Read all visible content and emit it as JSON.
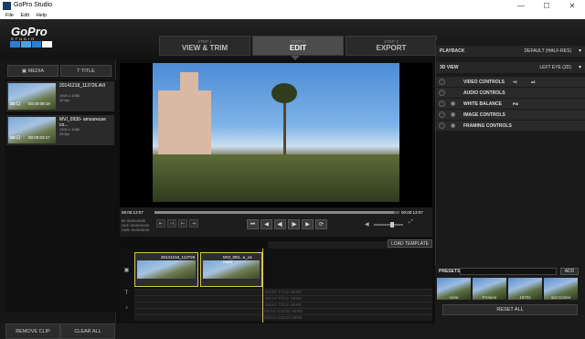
{
  "window": {
    "title": "GoPro Studio",
    "min": "—",
    "max": "☐",
    "close": "✕"
  },
  "menu": [
    "File",
    "Edit",
    "Help"
  ],
  "logo": {
    "text": "GoPro",
    "sub": "STUDIO"
  },
  "steps": [
    {
      "num": "STEP 1",
      "label": "VIEW & TRIM"
    },
    {
      "num": "STEP 2",
      "label": "EDIT"
    },
    {
      "num": "STEP 3",
      "label": "EXPORT"
    }
  ],
  "left_tabs": {
    "media": "MEDIA",
    "title": "TITLE"
  },
  "media": [
    {
      "name": "20141218_113726.AVI",
      "res": "1920 x 1080",
      "fps": "30 fps",
      "tags": "2D  ☐",
      "dur": "00:00:09:18"
    },
    {
      "name": "MVI_0930- amoureuse co...",
      "res": "1920 x 1080",
      "fps": "25 fps",
      "tags": "2D  ☐",
      "dur": "00:00:03:17"
    }
  ],
  "left_buttons": {
    "remove": "REMOVE CLIP",
    "clear": "CLEAR ALL"
  },
  "transport": {
    "time_start": "00:00:13:07",
    "time_end": "00:00:13:07",
    "in": "IN: 00:00:00:00",
    "out": "OUT: 00:00:00:00",
    "dur": "DUR: 00:00:00:00",
    "time_right": "00:00:13:07",
    "load_template": "LOAD TEMPLATE"
  },
  "timeline": {
    "clip1_title": "20141218_113726",
    "clip2_title": "MVI_093...e_ca nada",
    "title_tracks": [
      "DRAG TITLE HERE",
      "DRAG TITLE HERE",
      "DRAG TITLE HERE"
    ],
    "audio_tracks": [
      "DRAG AUDIO HERE",
      "DRAG AUDIO HERE"
    ]
  },
  "right": {
    "playback": {
      "label": "PLAYBACK",
      "value": "DEFAULT (HALF-RES)"
    },
    "view3d": {
      "label": "3D VIEW",
      "value": "LEFT EYE (2D)"
    },
    "controls": [
      {
        "label": "VIDEO CONTROLS",
        "badges": [
          "+2",
          "x2"
        ]
      },
      {
        "label": "AUDIO CONTROLS",
        "badges": []
      },
      {
        "label": "WHITE BALANCE",
        "badges": [
          "FIX"
        ]
      },
      {
        "label": "IMAGE CONTROLS",
        "badges": []
      },
      {
        "label": "FRAMING CONTROLS",
        "badges": []
      }
    ],
    "presets": {
      "label": "PRESETS",
      "add": "ADD",
      "reset": "RESET ALL",
      "items": [
        "none",
        "Protune",
        "1970s",
        "4x3 Center"
      ]
    }
  }
}
